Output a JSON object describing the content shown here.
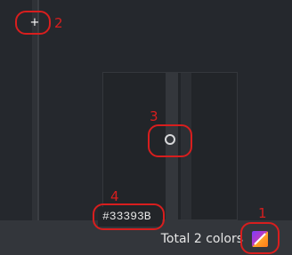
{
  "palette_editor": {
    "add_icon": "plus-icon",
    "add_symbol": "+",
    "hex_value": "#33393B",
    "total_label": "Total 2 colors",
    "gradient_icon": "gradient-palette-icon",
    "colors": {
      "panel_bg": "#25282d",
      "bar_bg": "#33363b",
      "field_bg": "#222529",
      "selected_color": "#33393B",
      "annotation": "#d81e1e"
    }
  },
  "annotations": {
    "labels": [
      "1",
      "2",
      "3",
      "4"
    ]
  }
}
